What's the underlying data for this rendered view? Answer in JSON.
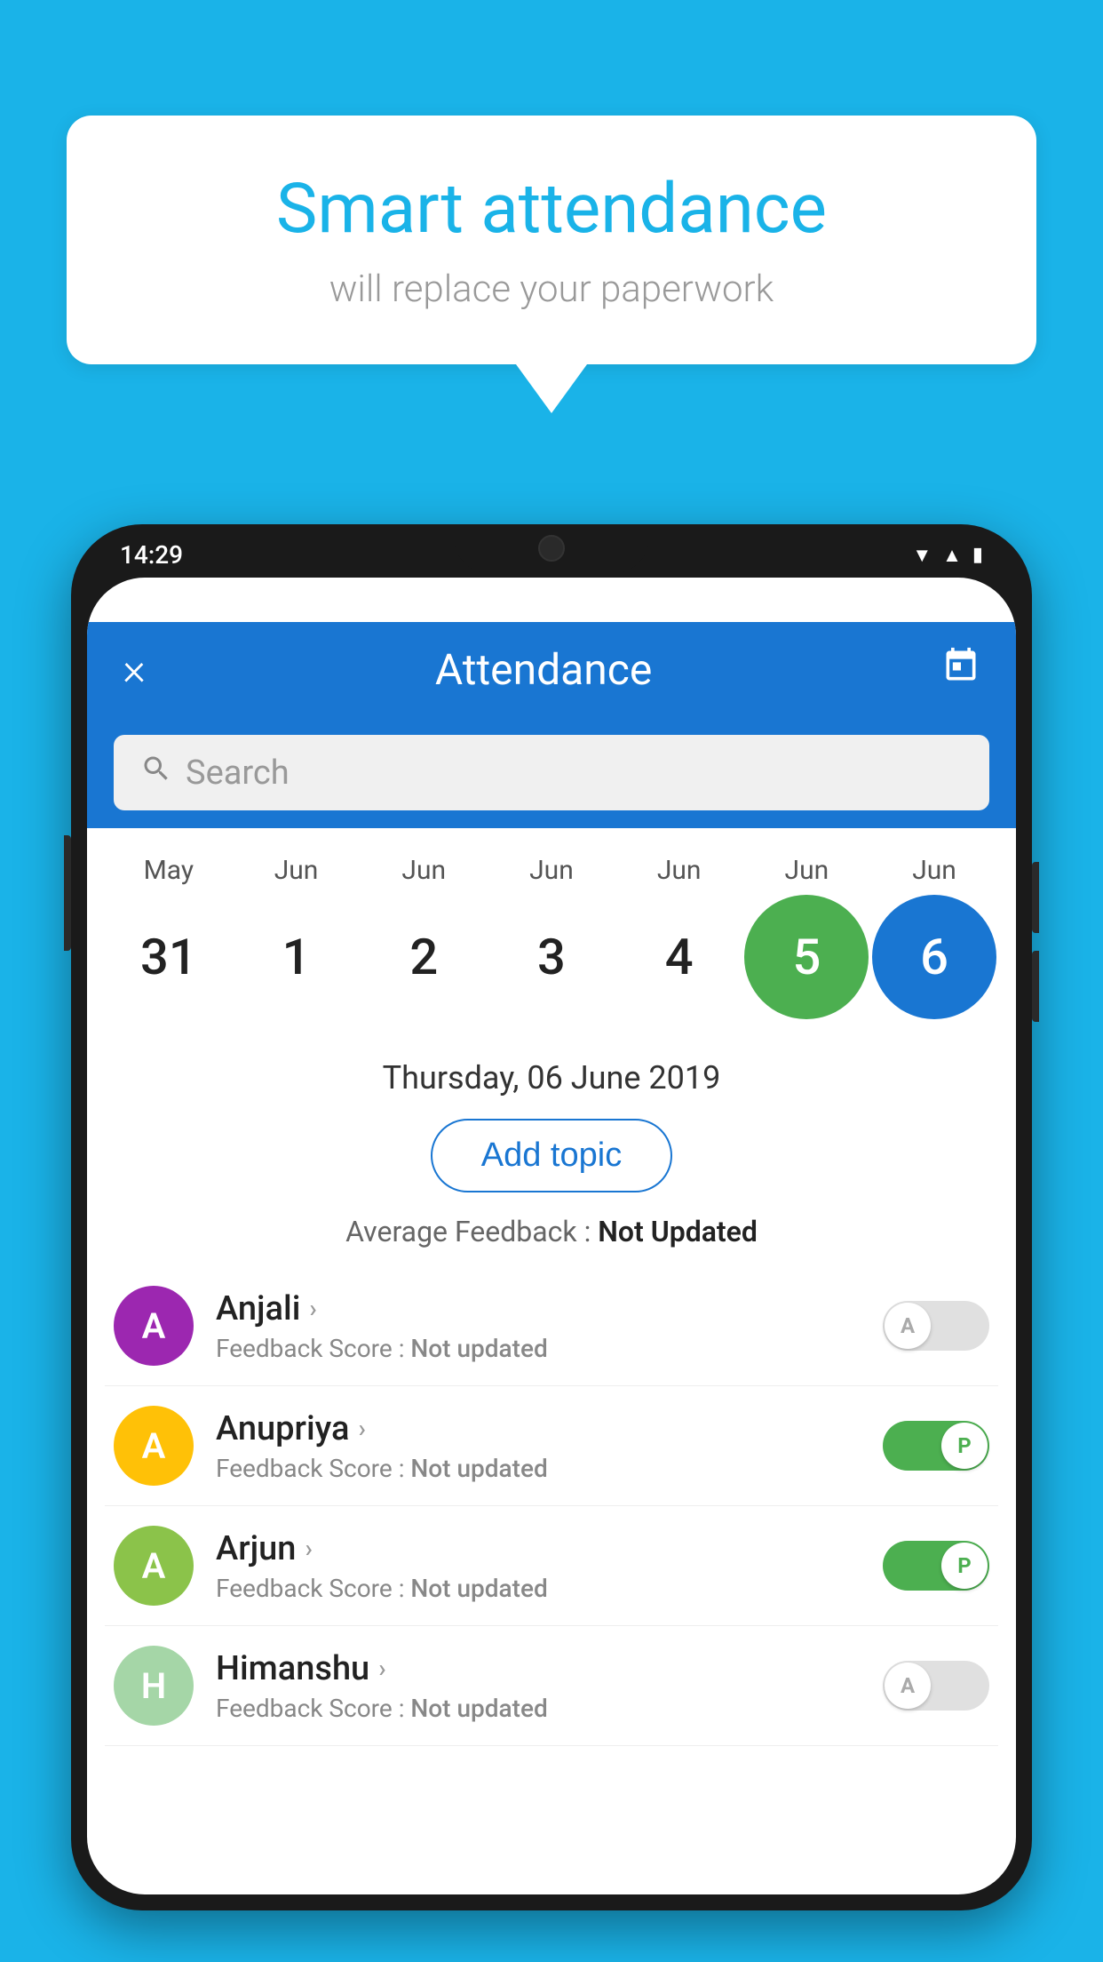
{
  "page": {
    "background_color": "#1ab3e8"
  },
  "speech_bubble": {
    "title": "Smart attendance",
    "subtitle": "will replace your paperwork"
  },
  "app": {
    "status_bar": {
      "time": "14:29",
      "icons": [
        "wifi",
        "signal",
        "battery"
      ]
    },
    "header": {
      "title": "Attendance",
      "close_label": "×",
      "calendar_icon": "📅"
    },
    "search": {
      "placeholder": "Search"
    },
    "calendar": {
      "months": [
        "May",
        "Jun",
        "Jun",
        "Jun",
        "Jun",
        "Jun",
        "Jun"
      ],
      "dates": [
        "31",
        "1",
        "2",
        "3",
        "4",
        "5",
        "6"
      ],
      "today_index": 5,
      "selected_index": 6
    },
    "selected_date_label": "Thursday, 06 June 2019",
    "add_topic_label": "Add topic",
    "average_feedback": {
      "label": "Average Feedback : ",
      "value": "Not Updated"
    },
    "students": [
      {
        "name": "Anjali",
        "avatar_letter": "A",
        "avatar_color": "#9c27b0",
        "feedback_label": "Feedback Score : ",
        "feedback_value": "Not updated",
        "attendance": "absent",
        "toggle_label": "A"
      },
      {
        "name": "Anupriya",
        "avatar_letter": "A",
        "avatar_color": "#ffc107",
        "feedback_label": "Feedback Score : ",
        "feedback_value": "Not updated",
        "attendance": "present",
        "toggle_label": "P"
      },
      {
        "name": "Arjun",
        "avatar_letter": "A",
        "avatar_color": "#8bc34a",
        "feedback_label": "Feedback Score : ",
        "feedback_value": "Not updated",
        "attendance": "present",
        "toggle_label": "P"
      },
      {
        "name": "Himanshu",
        "avatar_letter": "H",
        "avatar_color": "#a5d6a7",
        "feedback_label": "Feedback Score : ",
        "feedback_value": "Not updated",
        "attendance": "absent",
        "toggle_label": "A"
      }
    ]
  }
}
